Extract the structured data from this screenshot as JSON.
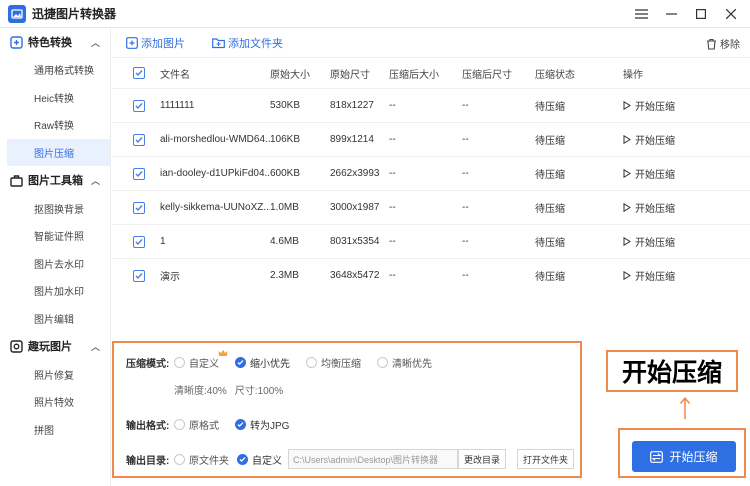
{
  "app": {
    "title": "迅捷图片转换器"
  },
  "sidebar": {
    "groups": [
      {
        "label": "特色转换",
        "items": [
          "通用格式转换",
          "Heic转换",
          "Raw转换",
          "图片压缩"
        ]
      },
      {
        "label": "图片工具箱",
        "items": [
          "抠图换背景",
          "智能证件照",
          "图片去水印",
          "图片加水印",
          "图片编辑"
        ]
      },
      {
        "label": "趣玩图片",
        "items": [
          "照片修复",
          "照片特效",
          "拼图"
        ]
      }
    ],
    "active_item": "图片压缩"
  },
  "toolbar": {
    "add_image": "添加图片",
    "add_folder": "添加文件夹",
    "remove": "移除"
  },
  "table": {
    "headers": [
      "文件名",
      "原始大小",
      "原始尺寸",
      "压缩后大小",
      "压缩后尺寸",
      "压缩状态",
      "操作"
    ],
    "rows": [
      {
        "name": "1111111",
        "osize": "530KB",
        "odim": "818x1227",
        "csize": "--",
        "cdim": "--",
        "status": "待压缩",
        "action": "开始压缩"
      },
      {
        "name": "ali-morshedlou-WMD64...",
        "osize": "106KB",
        "odim": "899x1214",
        "csize": "--",
        "cdim": "--",
        "status": "待压缩",
        "action": "开始压缩"
      },
      {
        "name": "ian-dooley-d1UPkiFd04...",
        "osize": "600KB",
        "odim": "2662x3993",
        "csize": "--",
        "cdim": "--",
        "status": "待压缩",
        "action": "开始压缩"
      },
      {
        "name": "kelly-sikkema-UUNoXZ...",
        "osize": "1.0MB",
        "odim": "3000x1987",
        "csize": "--",
        "cdim": "--",
        "status": "待压缩",
        "action": "开始压缩"
      },
      {
        "name": "1",
        "osize": "4.6MB",
        "odim": "8031x5354",
        "csize": "--",
        "cdim": "--",
        "status": "待压缩",
        "action": "开始压缩"
      },
      {
        "name": "演示",
        "osize": "2.3MB",
        "odim": "3648x5472",
        "csize": "--",
        "cdim": "--",
        "status": "待压缩",
        "action": "开始压缩"
      }
    ]
  },
  "settings": {
    "mode_label": "压缩模式:",
    "modes": [
      "自定义",
      "缩小优先",
      "均衡压缩",
      "清晰优先"
    ],
    "selected_mode": "缩小优先",
    "clarity": "清晰度:40%",
    "size": "尺寸:100%",
    "format_label": "输出格式:",
    "formats": [
      "原格式",
      "转为JPG"
    ],
    "selected_format": "转为JPG",
    "dir_label": "输出目录:",
    "dirs": [
      "原文件夹",
      "自定义"
    ],
    "selected_dir": "自定义",
    "path": "C:\\Users\\admin\\Desktop\\图片转换器",
    "change_dir": "更改目录",
    "open_folder": "打开文件夹"
  },
  "annotation": {
    "callout": "开始压缩"
  },
  "start_button": {
    "label": "开始压缩"
  },
  "colors": {
    "accent": "#2f6fe4",
    "highlight": "#ef8a4c"
  }
}
